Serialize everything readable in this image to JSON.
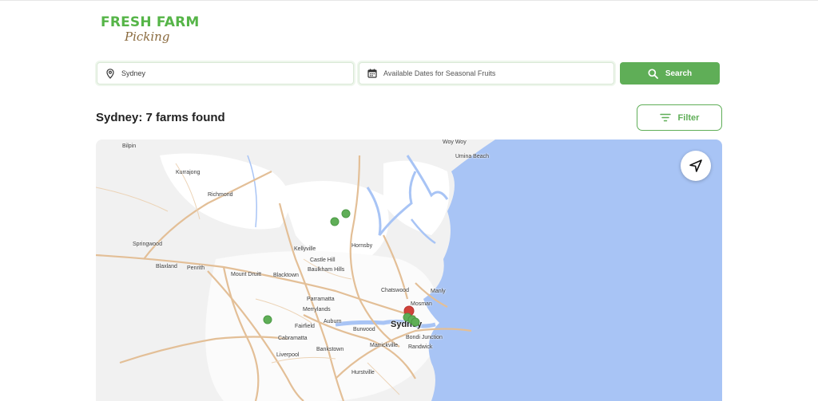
{
  "logo": {
    "line1": "FRESH FARM",
    "line2": "Picking"
  },
  "search": {
    "location_value": "Sydney",
    "date_placeholder": "Available Dates for Seasonal Fruits",
    "button_label": "Search"
  },
  "results": {
    "heading": "Sydney: 7 farms found"
  },
  "filter": {
    "label": "Filter"
  },
  "colors": {
    "brand_green": "#5fae57",
    "water": "#a8c4f5",
    "pin_red": "#d0433a"
  },
  "map": {
    "labels": [
      "Bilpin",
      "Woy Woy",
      "Umina Beach",
      "Kurrajong",
      "Richmond",
      "Springwood",
      "Blaxland",
      "Penrith",
      "Kellyville",
      "Castle Hill",
      "Baulkham Hills",
      "Hornsby",
      "Mount Druitt",
      "Blacktown",
      "Chatswood",
      "Manly",
      "Parramatta",
      "Mosman",
      "Merrylands",
      "Fairfield",
      "Auburn",
      "Burwood",
      "Sydney",
      "Cabramatta",
      "Marrickville",
      "Bondi Junction",
      "Randwick",
      "Bankstown",
      "Liverpool",
      "Hurstville"
    ],
    "farm_count": 7
  }
}
